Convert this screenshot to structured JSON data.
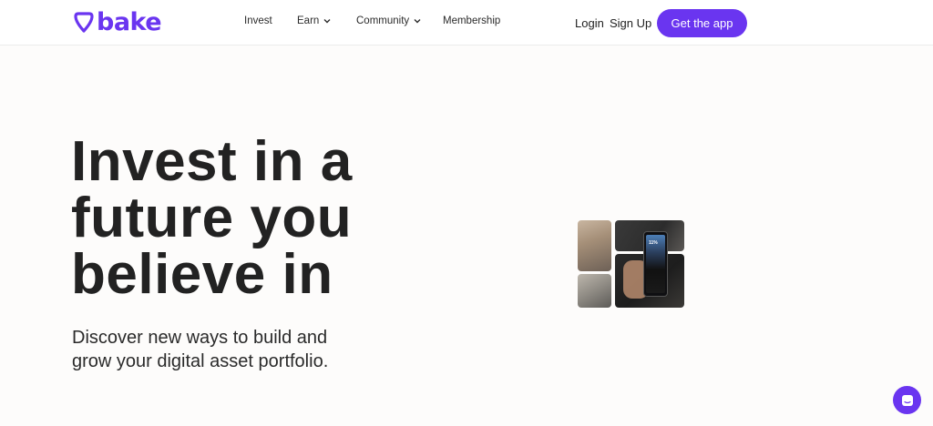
{
  "brand": {
    "name": "bake",
    "accent": "#6a35f0"
  },
  "nav": [
    {
      "label": "Invest",
      "dropdown": false
    },
    {
      "label": "Earn",
      "dropdown": true
    },
    {
      "label": "Community",
      "dropdown": true
    },
    {
      "label": "Membership",
      "dropdown": false
    }
  ],
  "auth": {
    "login": "Login",
    "signup": "Sign Up",
    "cta": "Get the app"
  },
  "hero": {
    "title": "Invest in a future you believe in",
    "subtitle": "Discover new ways to build and grow your digital asset portfolio."
  },
  "collage": {
    "phone_value": "11%"
  },
  "chat": {
    "icon": "chat-icon"
  }
}
